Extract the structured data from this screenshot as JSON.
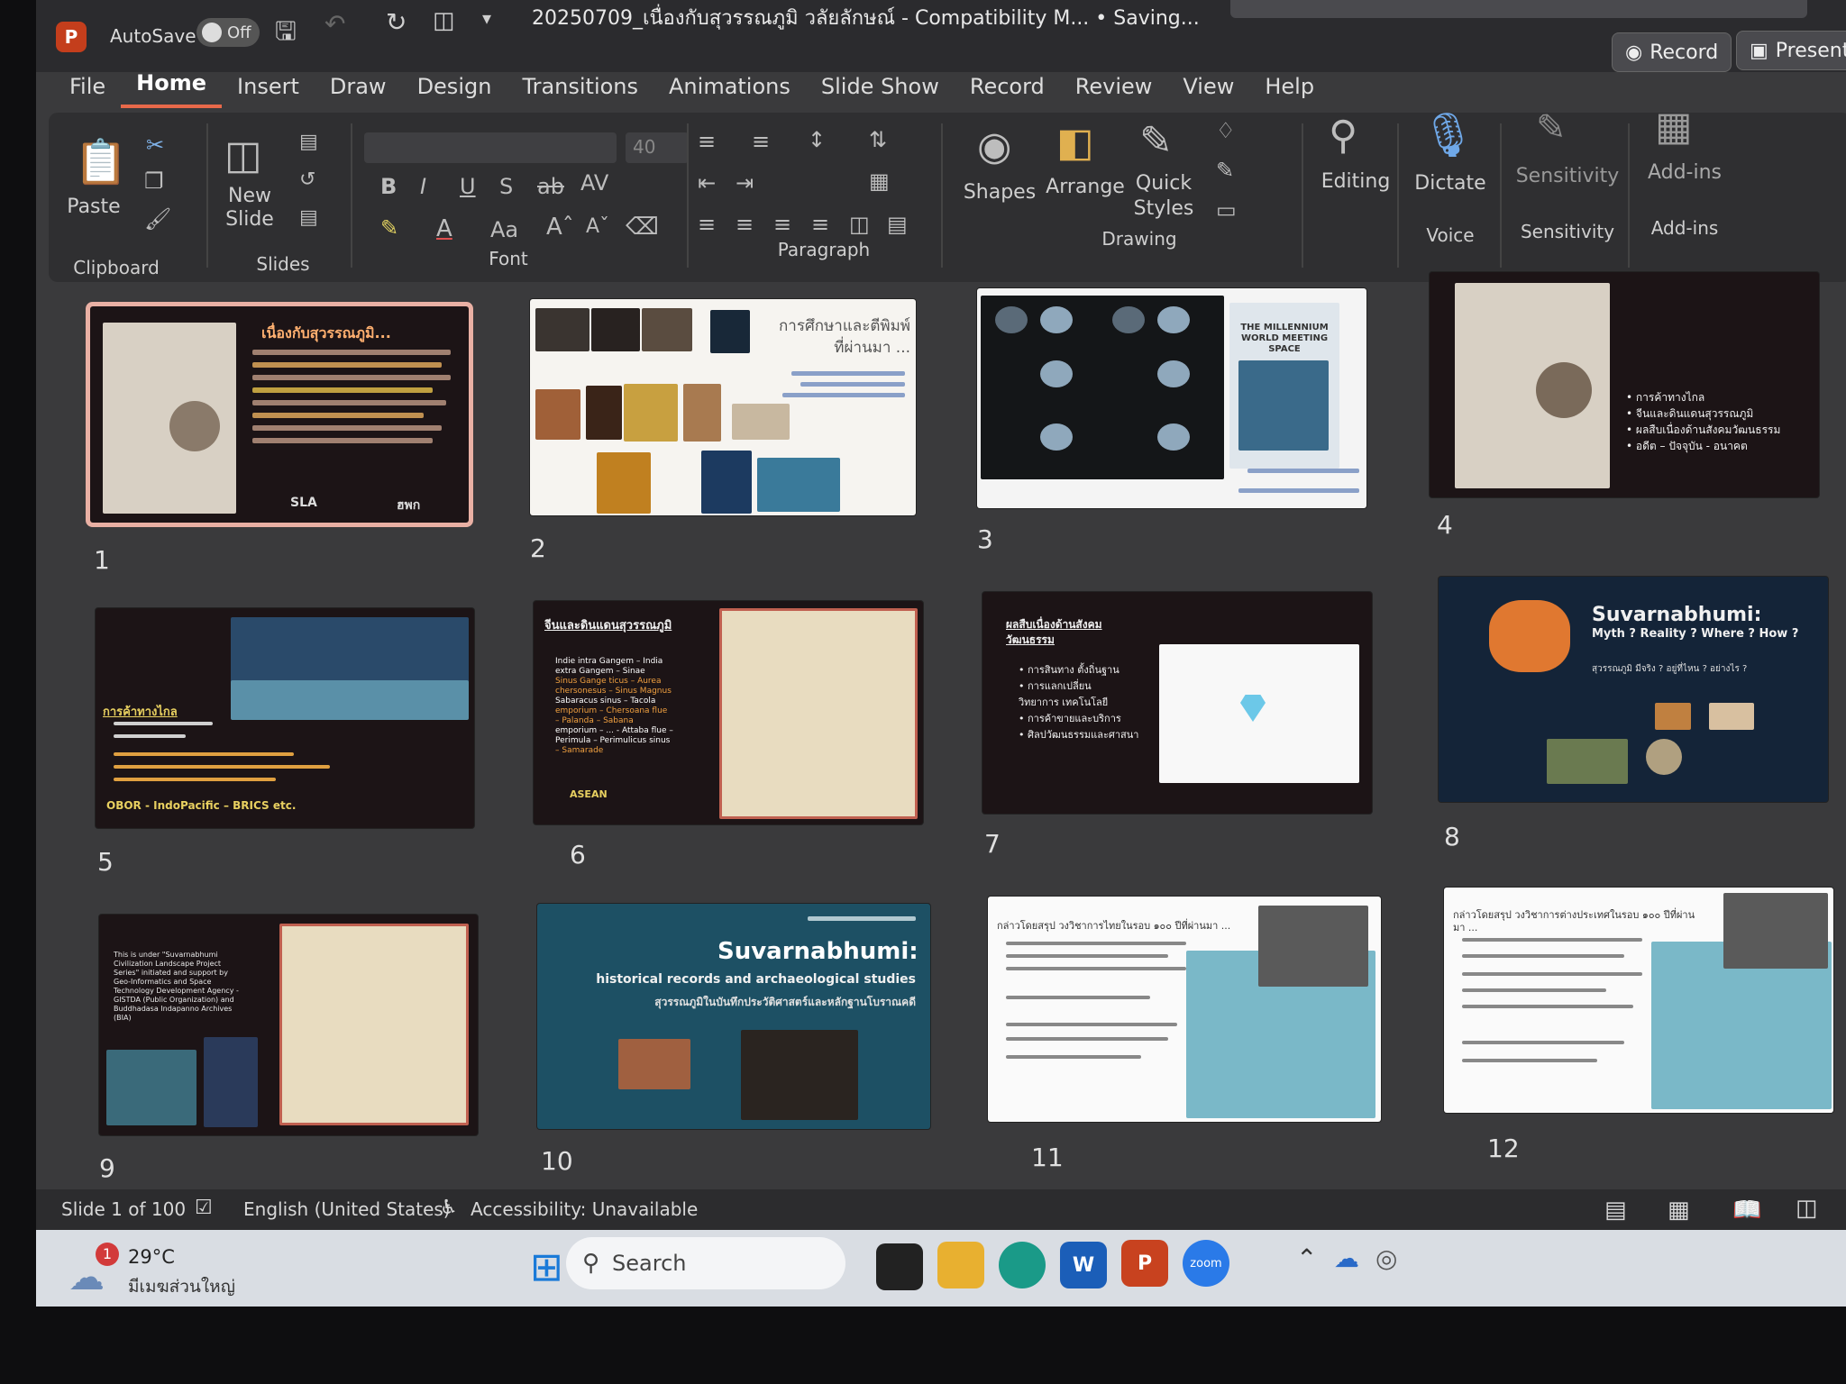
{
  "titlebar": {
    "app_icon": "P",
    "autosave_label": "AutoSave",
    "autosave_state": "Off",
    "document_title": "20250709_เนื่องกับสุวรรณภูมิ วลัยลักษณ์ - Compatibility M...  • Saving...",
    "record_button": "Record",
    "present_button": "Present"
  },
  "tabs": [
    "File",
    "Home",
    "Insert",
    "Draw",
    "Design",
    "Transitions",
    "Animations",
    "Slide Show",
    "Record",
    "Review",
    "View",
    "Help"
  ],
  "ribbon": {
    "paste": "Paste",
    "clipboard": "Clipboard",
    "new_slide_1": "New",
    "new_slide_2": "Slide",
    "slides": "Slides",
    "font_size": "40",
    "font": "Font",
    "paragraph": "Paragraph",
    "shapes": "Shapes",
    "arrange": "Arrange",
    "quick_1": "Quick",
    "quick_2": "Styles",
    "drawing": "Drawing",
    "editing": "Editing",
    "dictate": "Dictate",
    "voice": "Voice",
    "sensitivity": "Sensitivity",
    "sensitivity_group": "Sensitivity",
    "addins": "Add-ins",
    "addins_group": "Add-ins"
  },
  "slides": {
    "s1": {
      "num": "1",
      "title": "เนื่องกับสุวรรณภูมิ...",
      "footer_left": "SLA",
      "footer_right": "ฮพก"
    },
    "s2": {
      "num": "2",
      "title": "การศึกษาและตีพิมพ์ ที่ผ่านมา ..."
    },
    "s3": {
      "num": "3",
      "title": "THE MILLENNIUM WORLD MEETING SPACE"
    },
    "s4": {
      "num": "4",
      "bullets": [
        "การค้าทางไกล",
        "จีนและดินแดนสุวรรณภูมิ",
        "ผลสืบเนื่องด้านสังคมวัฒนธรรม",
        "อดีต – ปัจจุบัน - อนาคต"
      ]
    },
    "s5": {
      "num": "5",
      "heading": "การค้าทางไกล",
      "footer": "OBOR - IndoPacific – BRICS etc."
    },
    "s6": {
      "num": "6",
      "heading": "จีนและดินแดนสุวรรณภูมิ",
      "lines": [
        "Indie intra Gangem – India",
        "extra Gangem – Sinae",
        "Sinus Gange ticus – Aurea",
        "chersonesus – Sinus Magnus",
        "Sabaracus sinus – Tacola",
        "emporium – Chersoana flue",
        "– Palanda – Sabana",
        "emporium – ... - Attaba flue –",
        "Perimula – Perimulicus sinus",
        "– Samarade"
      ],
      "footer": "ASEAN"
    },
    "s7": {
      "num": "7",
      "heading": "ผลสืบเนื่องด้านสังคมวัฒนธรรม",
      "bullets": [
        "การสินทาง ตั้งถิ่นฐาน",
        "การแลกเปลี่ยนวิทยาการ เทคโนโลยี",
        "การค้าขายและบริการ",
        "ศิลปวัฒนธรรมและศาสนา"
      ]
    },
    "s8": {
      "num": "8",
      "title": "Suvarnabhumi:",
      "subtitle": "Myth ? Reality ? Where ? How ?",
      "thai": "สุวรรณภูมิ มีจริง ? อยู่ที่ไหน ? อย่างไร ?"
    },
    "s9": {
      "num": "9",
      "text": "This is under \"Suvarnabhumi Civilization Landscape Project Series\" initiated and support by Geo-Informatics and Space Technology Development Agency - GISTDA (Public Organization) and Buddhadasa Indapanno Archives (BIA)"
    },
    "s10": {
      "num": "10",
      "title": "Suvarnabhumi:",
      "subtitle": "historical records and archaeological studies",
      "thai": "สุวรรณภูมิในบันทึกประวัติศาสตร์และหลักฐานโบราณคดี"
    },
    "s11": {
      "num": "11",
      "title": "กล่าวโดยสรุป วงวิชาการไทยในรอบ ๑๐๐ ปีที่ผ่านมา ..."
    },
    "s12": {
      "num": "12",
      "title": "กล่าวโดยสรุป วงวิชาการต่างประเทศในรอบ ๑๐๐ ปีที่ผ่านมา ..."
    }
  },
  "statusbar": {
    "slide_counter": "Slide 1 of 100",
    "language": "English (United States)",
    "accessibility": "Accessibility: Unavailable"
  },
  "taskbar": {
    "temperature": "29°C",
    "weather": "มีเมฆส่วนใหญ่",
    "notification_count": "1",
    "search": "Search",
    "zoom_label": "zoom"
  }
}
